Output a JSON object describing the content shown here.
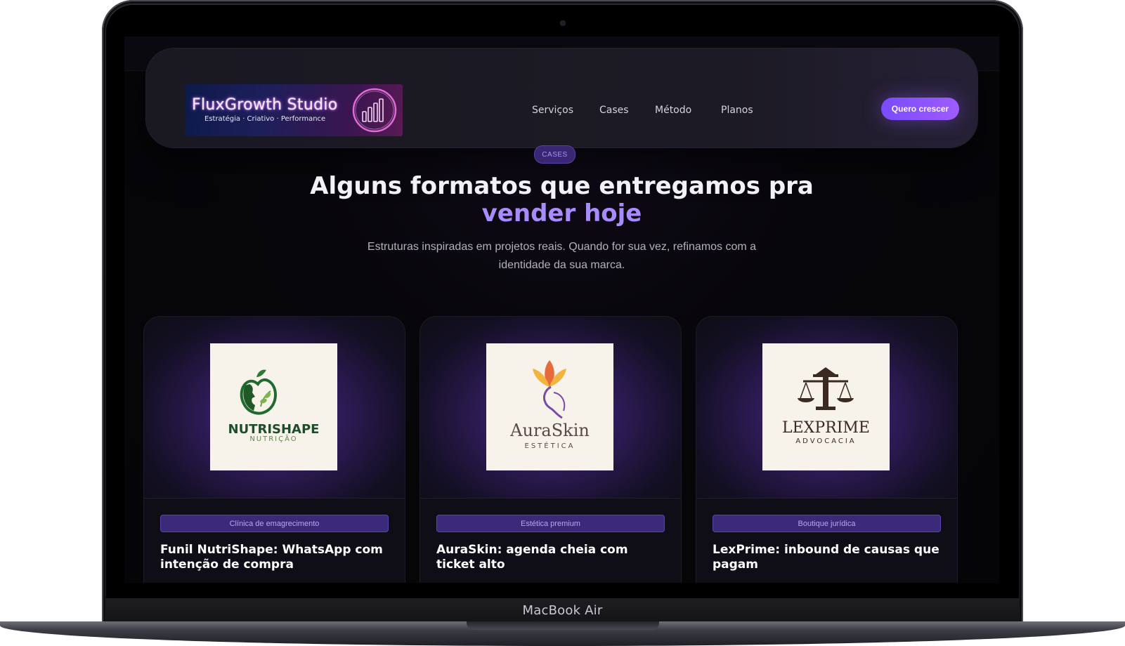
{
  "device": {
    "label": "MacBook Air"
  },
  "header": {
    "logo": {
      "title": "FluxGrowth Studio",
      "tagline": "Estratégia · Criativo · Performance"
    },
    "nav": [
      "Serviços",
      "Cases",
      "Método",
      "Planos"
    ],
    "cta_label": "Quero crescer"
  },
  "hero": {
    "pill": "CASES",
    "title_part1": "Alguns formatos que entregamos pra",
    "title_part2": "vender hoje",
    "subtitle": "Estruturas inspiradas em projetos reais. Quando for sua vez, refinamos com a identidade da sua marca."
  },
  "cases": [
    {
      "brand": "NUTRISHAPE",
      "brand_sub": "NUTRIÇÃO",
      "tag": "Clínica de emagrecimento",
      "title": "Funil NutriShape: WhatsApp com intenção de compra",
      "icon": "apple-face-icon"
    },
    {
      "brand": "AuraSkin",
      "brand_sub": "ESTÉTICA",
      "tag": "Estética premium",
      "title": "AuraSkin: agenda cheia com ticket alto",
      "icon": "lotus-face-icon"
    },
    {
      "brand": "LEXPRIME",
      "brand_sub": "ADVOCACIA",
      "tag": "Boutique jurídica",
      "title": "LexPrime: inbound de causas que pagam",
      "icon": "scales-icon"
    }
  ],
  "colors": {
    "accent": "#8a55ff",
    "accent_text": "#a88bff",
    "background": "#07060a",
    "tag_bg": "#3b2a7a"
  }
}
